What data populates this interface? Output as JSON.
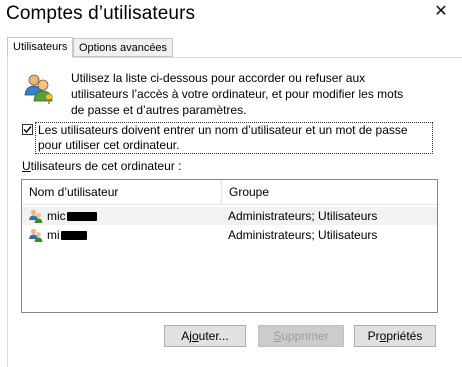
{
  "window": {
    "title": "Comptes d’utilisateurs",
    "close_glyph": "✕"
  },
  "tabs": [
    {
      "label": "Utilisateurs",
      "active": true
    },
    {
      "label": "Options avancées",
      "active": false
    }
  ],
  "intro": {
    "icon": "users-icon",
    "text": "Utilisez la liste ci-dessous pour accorder ou refuser aux utilisateurs l’accès à votre ordinateur, et pour modifier les mots de passe et d’autres paramètres."
  },
  "require_password": {
    "checked": true,
    "label": "Les utilisateurs doivent entrer un nom d’utilisateur et un mot de passe pour utiliser cet ordinateur."
  },
  "users_group": {
    "label": "Utilisateurs de cet ordinateur :",
    "columns": [
      "Nom d’utilisateur",
      "Groupe"
    ],
    "rows": [
      {
        "name_visible": "mic",
        "redacted": true,
        "group": "Administrateurs; Utilisateurs",
        "selected": true
      },
      {
        "name_visible": "mi",
        "redacted": true,
        "group": "Administrateurs; Utilisateurs",
        "selected": false
      }
    ]
  },
  "buttons": {
    "add": {
      "prefix": "Aj",
      "underline": "o",
      "suffix": "uter...",
      "enabled": true
    },
    "remove": {
      "prefix": "",
      "underline": "S",
      "suffix": "upprimer",
      "enabled": false
    },
    "properties": {
      "prefix": "Pr",
      "underline": "o",
      "suffix": "priétés",
      "enabled": true
    }
  },
  "colors": {
    "selection_row": "#f2f2f2",
    "button_face": "#e1e1e1",
    "disabled_text": "#9c9c9c"
  }
}
